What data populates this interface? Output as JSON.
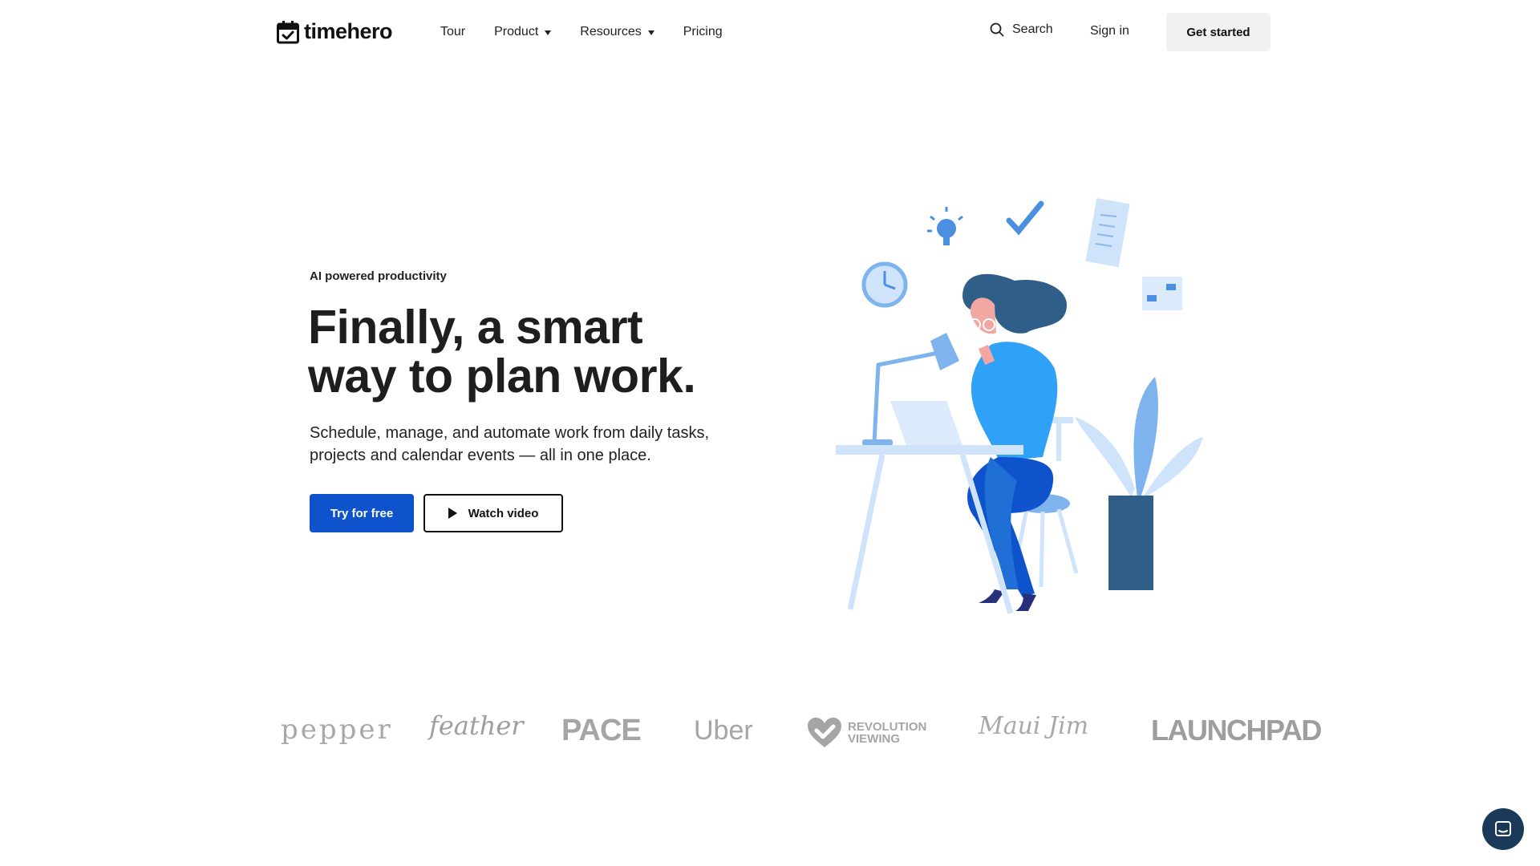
{
  "header": {
    "logo_text": "timehero",
    "nav": [
      {
        "label": "Tour",
        "has_dropdown": false
      },
      {
        "label": "Product",
        "has_dropdown": true
      },
      {
        "label": "Resources",
        "has_dropdown": true
      },
      {
        "label": "Pricing",
        "has_dropdown": false
      }
    ],
    "search_label": "Search",
    "signin_label": "Sign in",
    "cta_label": "Get started"
  },
  "hero": {
    "eyebrow": "AI powered productivity",
    "headline_line1": "Finally, a smart",
    "headline_line2": "way to plan work.",
    "subtext": "Schedule, manage, and automate work from daily tasks, projects and calendar events — all in one place.",
    "primary_button": "Try for free",
    "secondary_button": "Watch video"
  },
  "logos": {
    "pepper": "pepper",
    "feather": "feather",
    "pace": "PACE",
    "uber": "Uber",
    "revolution_line1": "REVOLUTION",
    "revolution_line2": "VIEWING",
    "maui": "Maui Jim",
    "launchpad": "LAUNCHPAD"
  },
  "colors": {
    "primary": "#0e52cc",
    "illustration_blue": "#2f9bf5",
    "illustration_dark": "#2f5f88",
    "illustration_light": "#cfe4fb"
  },
  "icons": {
    "search": "search-icon",
    "play": "play-icon",
    "chat": "chat-icon"
  }
}
